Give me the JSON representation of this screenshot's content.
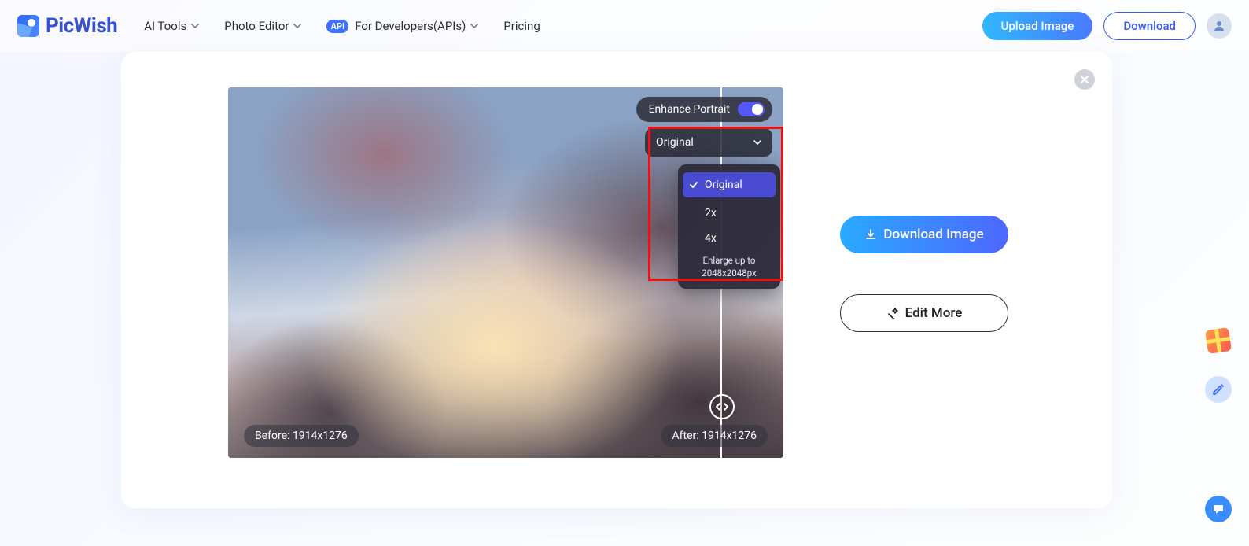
{
  "brand": {
    "name": "PicWish"
  },
  "nav": {
    "ai_tools": "AI Tools",
    "photo_editor": "Photo Editor",
    "for_dev": "For Developers(APIs)",
    "api_badge": "API",
    "pricing": "Pricing"
  },
  "header_actions": {
    "upload": "Upload Image",
    "download": "Download"
  },
  "preview": {
    "enhance_label": "Enhance Portrait",
    "before_label": "Before: 1914x1276",
    "after_label": "After: 1914x1276"
  },
  "scale_dropdown": {
    "selected": "Original",
    "options": [
      "Original",
      "2x",
      "4x"
    ],
    "note_line1": "Enlarge up to",
    "note_line2": "2048x2048px"
  },
  "actions": {
    "download": "Download Image",
    "edit_more": "Edit More"
  }
}
